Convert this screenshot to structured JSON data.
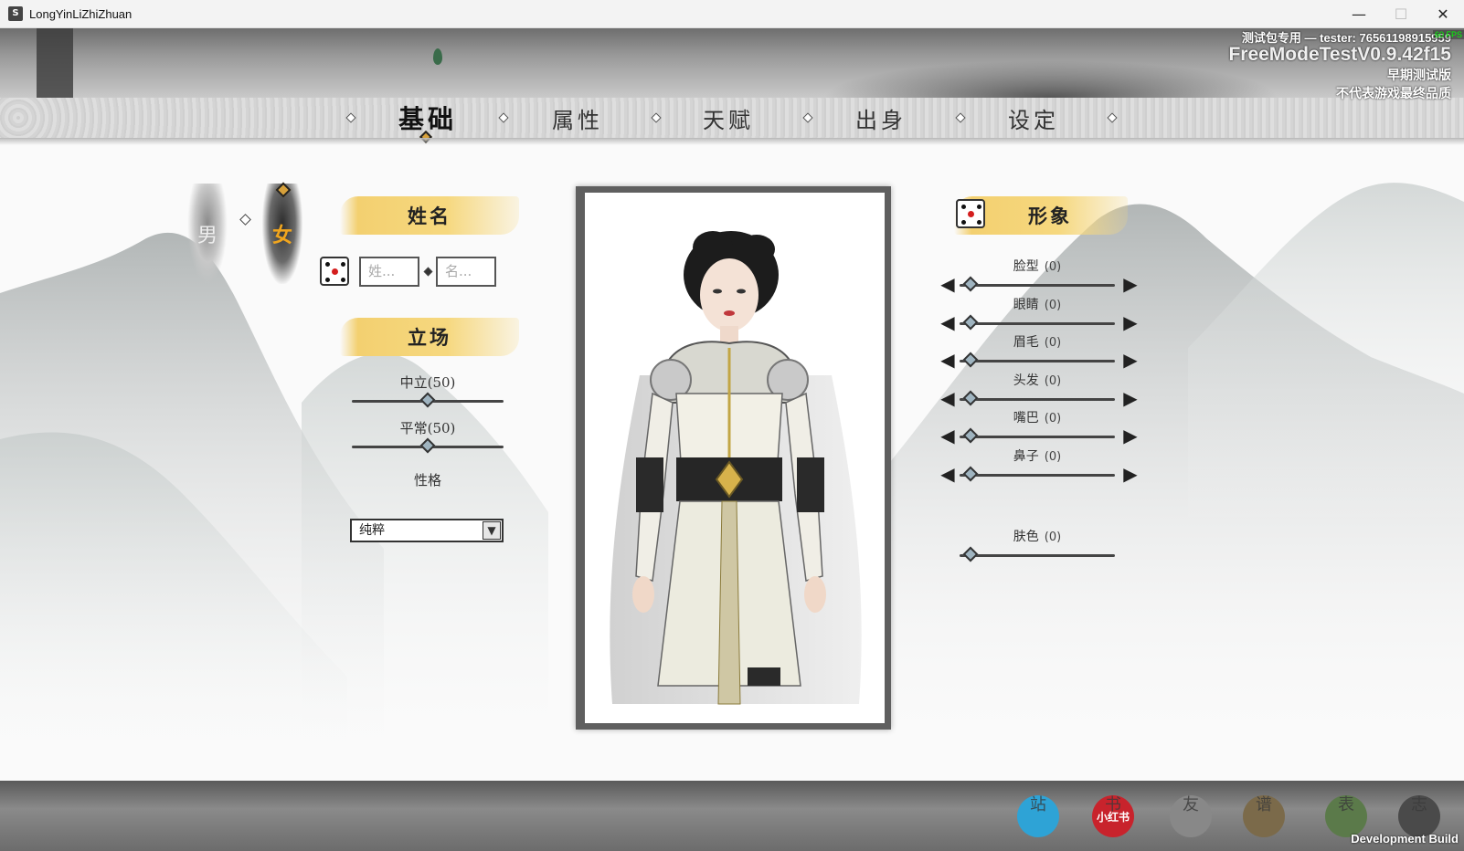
{
  "window": {
    "title": "LongYinLiZhiZhuan",
    "minimize": "—",
    "maximize": "☐",
    "close": "✕"
  },
  "overlay": {
    "tester_line": "测试包专用 — tester: 76561198915959",
    "fps": "60 FPS",
    "version": "FreeModeTestV0.9.42f15",
    "early_test": "早期测试版",
    "disclaimer": "不代表游戏最终品质"
  },
  "tabs": [
    {
      "label": "基础",
      "active": true
    },
    {
      "label": "属性",
      "active": false
    },
    {
      "label": "天赋",
      "active": false
    },
    {
      "label": "出身",
      "active": false
    },
    {
      "label": "设定",
      "active": false
    }
  ],
  "gender": {
    "male": "男",
    "female": "女",
    "selected": "female"
  },
  "name_section": {
    "header": "姓名",
    "surname_placeholder": "姓...",
    "given_placeholder": "名..."
  },
  "stance_section": {
    "header": "立场",
    "sliders": [
      {
        "label": "中立(50)",
        "value": 50,
        "max": 100
      },
      {
        "label": "平常(50)",
        "value": 50,
        "max": 100
      }
    ],
    "personality_label": "性格",
    "personality_value": "纯粹"
  },
  "appearance_section": {
    "header": "形象",
    "sliders": [
      {
        "label": "脸型",
        "value_text": "(0)",
        "value": 0
      },
      {
        "label": "眼睛",
        "value_text": "(0)",
        "value": 0
      },
      {
        "label": "眉毛",
        "value_text": "(0)",
        "value": 0
      },
      {
        "label": "头发",
        "value_text": "(0)",
        "value": 0
      },
      {
        "label": "嘴巴",
        "value_text": "(0)",
        "value": 0
      },
      {
        "label": "鼻子",
        "value_text": "(0)",
        "value": 0
      }
    ],
    "skin": {
      "label": "肤色",
      "value_text": "(0)",
      "value": 0
    }
  },
  "bottom_bar": {
    "icons": [
      {
        "name": "bilibili-icon",
        "glyph": "站",
        "color": "#2ea3d6"
      },
      {
        "name": "xiaohongshu-icon",
        "glyph": "书",
        "label": "小红书",
        "color": "#c8232c"
      },
      {
        "name": "qq-icon",
        "glyph": "友",
        "color": "#888888"
      },
      {
        "name": "scroll-icon",
        "glyph": "谱",
        "color": "#7b6a4a"
      },
      {
        "name": "jade-icon",
        "glyph": "表",
        "color": "#5b7a4a"
      },
      {
        "name": "pavilion-icon",
        "glyph": "志",
        "color": "#4a4a4a"
      }
    ],
    "dev_build": "Development Build"
  }
}
